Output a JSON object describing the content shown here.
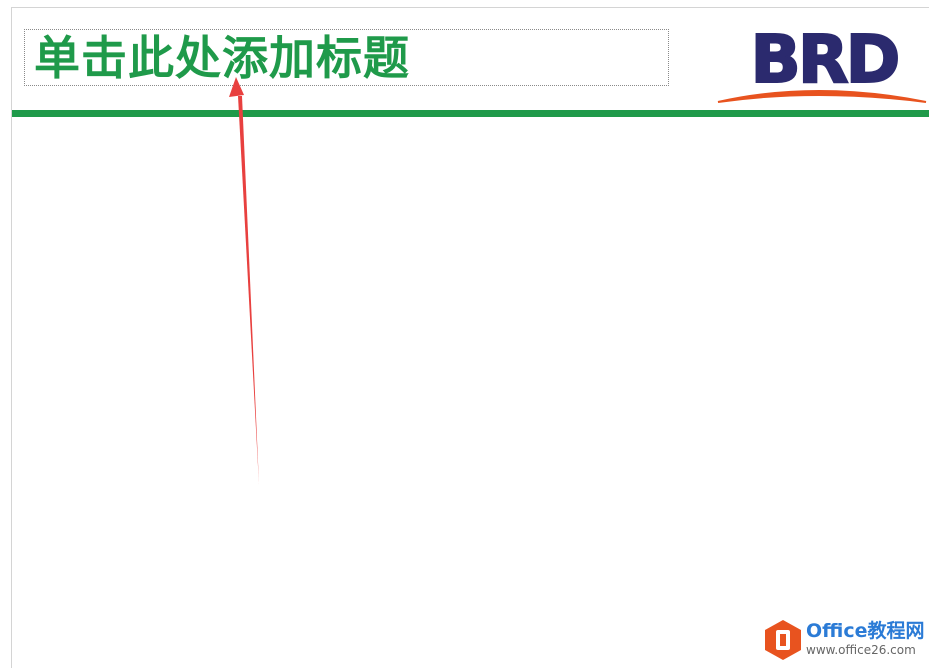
{
  "slide": {
    "title_placeholder": "单击此处添加标题",
    "logo_text": "BRD"
  },
  "watermark": {
    "name": "Office教程网",
    "url": "www.office26.com"
  },
  "colors": {
    "title_green": "#1f9a4a",
    "rule_green": "#1f9a4a",
    "logo_navy": "#2b2a6e",
    "logo_orange": "#e8531f",
    "arrow_red": "#e8403f",
    "watermark_orange": "#e8531f",
    "watermark_blue": "#2b7bd6",
    "watermark_gray": "#666666"
  },
  "icons": {
    "pointer_arrow": "arrow-icon",
    "watermark_logo": "office-logo-icon"
  }
}
